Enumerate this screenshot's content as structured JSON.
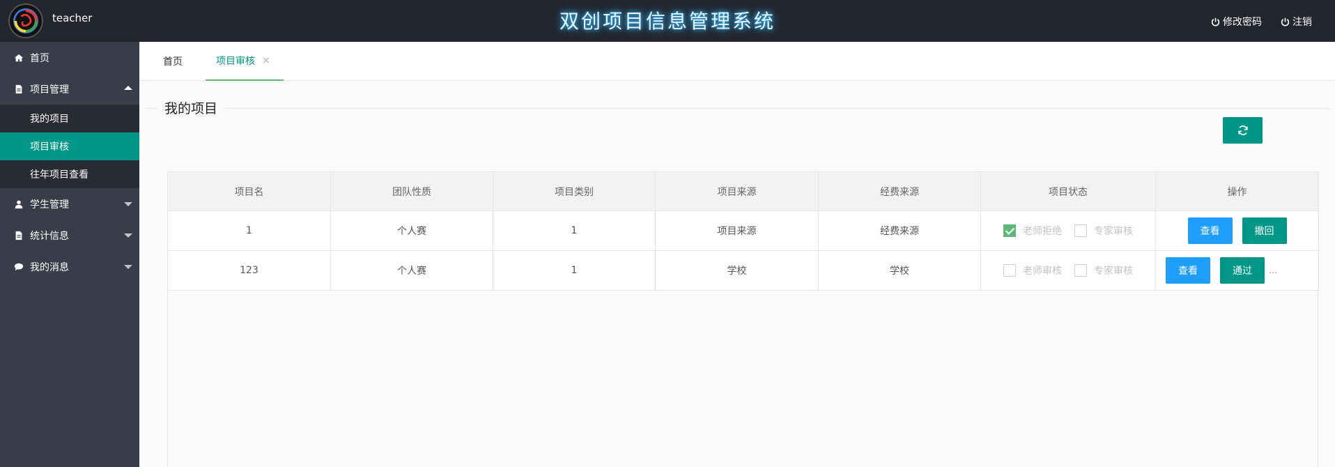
{
  "header": {
    "username": "teacher",
    "title": "双创项目信息管理系统",
    "change_password": "修改密码",
    "logout": "注销"
  },
  "sidebar": {
    "items": [
      {
        "label": "首页",
        "icon": "home-icon"
      },
      {
        "label": "项目管理",
        "icon": "file-icon",
        "expanded": true,
        "children": [
          {
            "label": "我的项目"
          },
          {
            "label": "项目审核",
            "active": true
          },
          {
            "label": "往年项目查看"
          }
        ]
      },
      {
        "label": "学生管理",
        "icon": "user-icon"
      },
      {
        "label": "统计信息",
        "icon": "file-icon"
      },
      {
        "label": "我的消息",
        "icon": "chat-icon"
      }
    ]
  },
  "tabs": [
    {
      "label": "首页"
    },
    {
      "label": "项目审核",
      "active": true,
      "close": "×"
    }
  ],
  "section": {
    "title": "我的项目"
  },
  "table": {
    "columns": [
      "项目名",
      "团队性质",
      "项目类别",
      "项目来源",
      "经费来源",
      "项目状态",
      "操作"
    ],
    "rows": [
      {
        "name": "1",
        "team": "个人赛",
        "category": "1",
        "source": "项目来源",
        "funding": "经费来源",
        "status": [
          {
            "label": "老师拒绝",
            "checked": true
          },
          {
            "label": "专家审核",
            "checked": false
          }
        ],
        "actions": [
          {
            "label": "查看",
            "color": "#1e9fff"
          },
          {
            "label": "撤回",
            "color": "#009688"
          }
        ],
        "more": ""
      },
      {
        "name": "123",
        "team": "个人赛",
        "category": "1",
        "source": "学校",
        "funding": "学校",
        "status": [
          {
            "label": "老师审核",
            "checked": false
          },
          {
            "label": "专家审核",
            "checked": false
          }
        ],
        "actions": [
          {
            "label": "查看",
            "color": "#1e9fff"
          },
          {
            "label": "通过",
            "color": "#009688"
          }
        ],
        "more": "..."
      }
    ]
  },
  "colors": {
    "header_bg": "#23262e",
    "sidebar_bg": "#393d49",
    "accent": "#009688",
    "blue": "#1e9fff",
    "check": "#5fb878"
  }
}
